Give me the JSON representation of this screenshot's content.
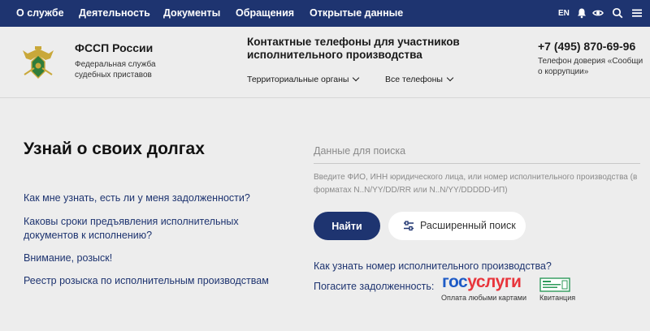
{
  "nav": {
    "items": [
      "О службе",
      "Деятельность",
      "Документы",
      "Обращения",
      "Открытые данные"
    ],
    "lang": "EN",
    "icons": [
      "bell-icon",
      "eye-icon",
      "search-icon",
      "menu-icon"
    ]
  },
  "header": {
    "org_name": "ФССП России",
    "org_subtitle": "Федеральная служба судебных приставов",
    "contacts_title": "Контактные телефоны для участников исполнительного производства",
    "dropdown_territorial": "Территориальные органы",
    "dropdown_all_phones": "Все телефоны",
    "phone": "+7 (495) 870-69-96",
    "hotline": "Телефон доверия «Сообщи о коррупции»"
  },
  "main": {
    "title": "Узнай о своих долгах",
    "questions": [
      "Как мне узнать, есть ли у меня задолженности?",
      "Каковы сроки предъявления исполнительных документов к исполнению?",
      "Внимание, розыск!",
      "Реестр розыска по исполнительным производствам"
    ],
    "search_placeholder": "Данные для поиска",
    "search_hint": "Введите ФИО, ИНН юридического лица, или номер исполнительного производства (в форматах N..N/YY/DD/RR или N..N/YY/DDDDD-ИП)",
    "find_button": "Найти",
    "advanced_button": "Расширенный поиск",
    "howto_link": "Как узнать номер исполнительного производства?",
    "pay_label": "Погасите задолженность:",
    "gosuslugi_part1": "гос",
    "gosuslugi_part2": "услуги",
    "pay_cards": "Оплата любыми картами",
    "receipt": "Квитанция"
  },
  "colors": {
    "brand": "#1e3470",
    "gosuslugi_blue": "#1e5bc6",
    "gosuslugi_red": "#e8343b",
    "background": "#ededed"
  }
}
